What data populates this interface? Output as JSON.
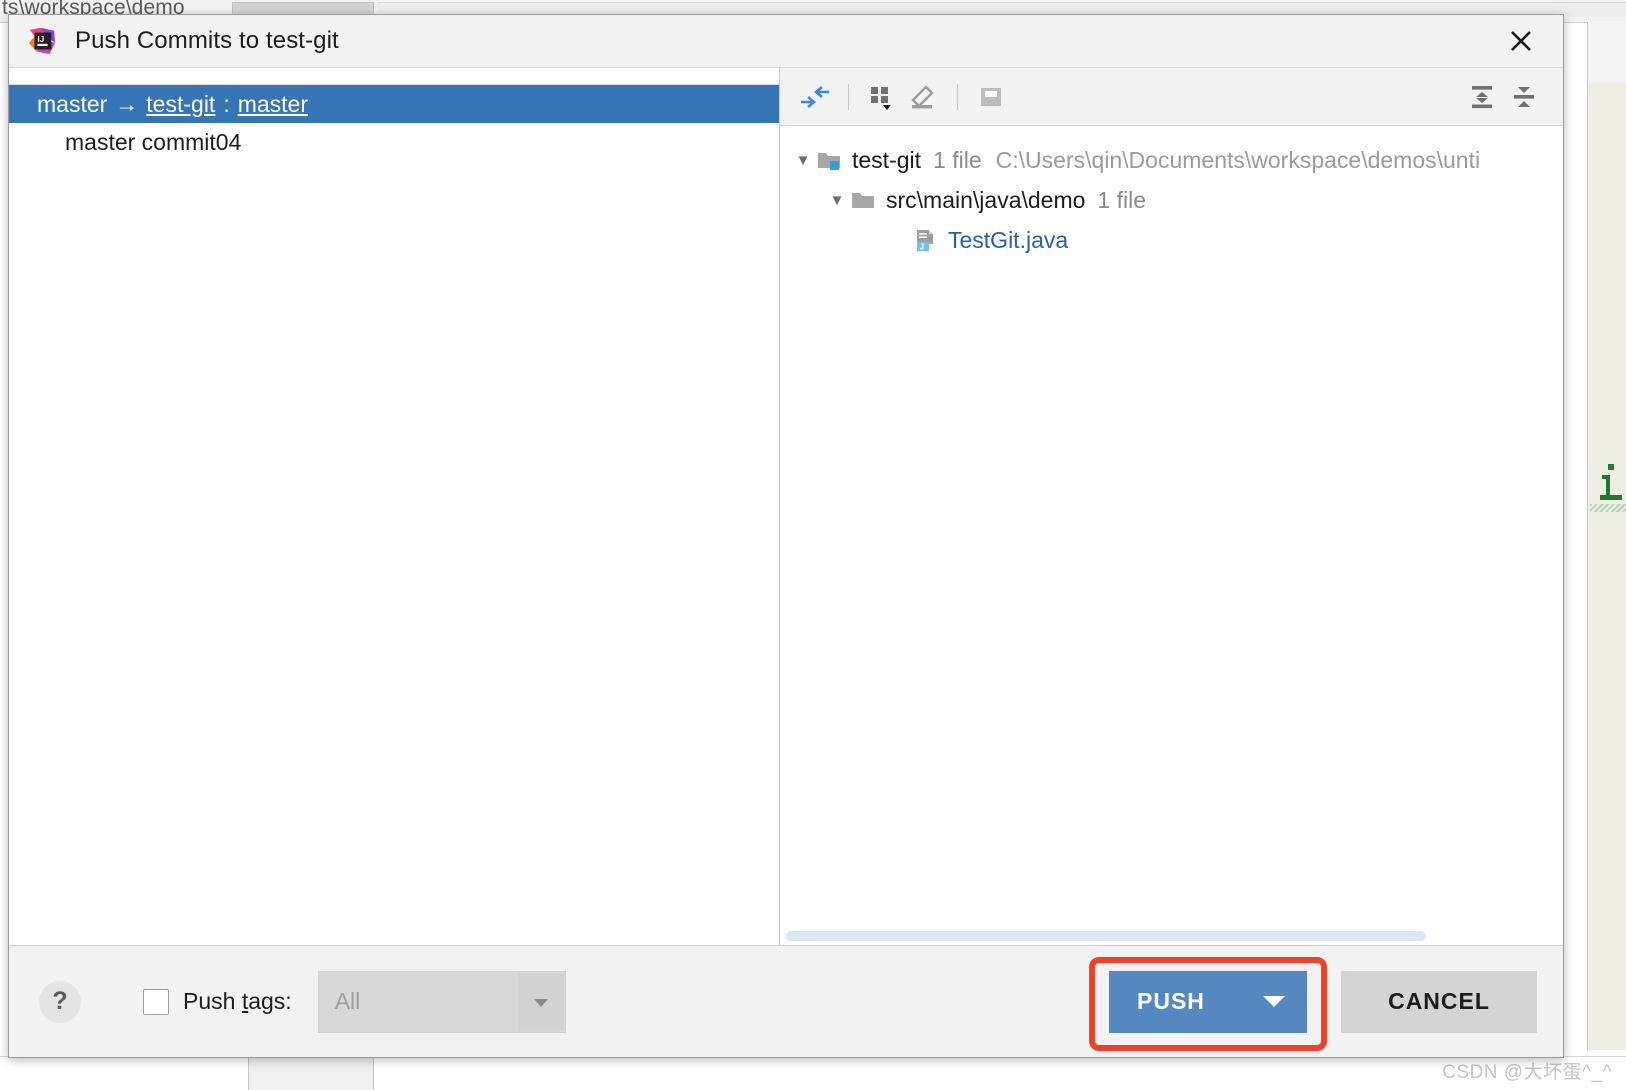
{
  "background": {
    "breadcrumb_text": "ts\\workspace\\demo",
    "watermark": "CSDN @大坏蛋^_^",
    "info_marker": "i"
  },
  "dialog": {
    "title": "Push Commits to test-git",
    "app_icon": "intellij-idea-logo",
    "close_icon": "close-icon"
  },
  "commits_panel": {
    "branch_row": {
      "source_branch": "master",
      "arrow": "→",
      "remote": "test-git",
      "separator": ":",
      "target_branch": "master"
    },
    "commits": [
      {
        "label": "master commit04"
      }
    ]
  },
  "changes_toolbar": {
    "buttons": [
      {
        "name": "show-diff-button",
        "icon": "diff-arrows-icon",
        "enabled": true
      },
      {
        "name": "group-by-button",
        "icon": "group-by-grid-icon",
        "enabled": true
      },
      {
        "name": "edit-source-button",
        "icon": "pencil-edit-icon",
        "enabled": true
      },
      {
        "name": "preview-diff-button",
        "icon": "preview-pane-icon",
        "enabled": false
      },
      {
        "name": "collapse-all-button",
        "icon": "collapse-all-icon",
        "enabled": true
      },
      {
        "name": "expand-all-button",
        "icon": "expand-all-icon",
        "enabled": true
      }
    ]
  },
  "file_tree": {
    "nodes": [
      {
        "level": 0,
        "twisty": "▼",
        "icon": "module-folder-icon",
        "label": "test-git",
        "meta": "1 file",
        "path": "C:\\Users\\qin\\Documents\\workspace\\demos\\unti",
        "is_link": false
      },
      {
        "level": 1,
        "twisty": "▼",
        "icon": "folder-icon",
        "label": "src\\main\\java\\demo",
        "meta": "1 file",
        "path": "",
        "is_link": false
      },
      {
        "level": 2,
        "twisty": "",
        "icon": "java-file-icon",
        "label": "TestGit.java",
        "meta": "",
        "path": "",
        "is_link": true
      }
    ]
  },
  "footer": {
    "help_label": "?",
    "push_tags_checked": false,
    "push_tags_label_pre": "Push ",
    "push_tags_label_mnemonic": "t",
    "push_tags_label_post": "ags:",
    "tags_combo_value": "All",
    "tags_combo_enabled": false,
    "push_button_label": "PUSH",
    "cancel_button_label": "CANCEL"
  },
  "colors": {
    "selection_blue": "#3675b5",
    "push_button_blue": "#5588c0",
    "highlight_red": "#f0412a",
    "link_blue": "#2b5faa",
    "dialog_bg": "#f2f2f2"
  }
}
